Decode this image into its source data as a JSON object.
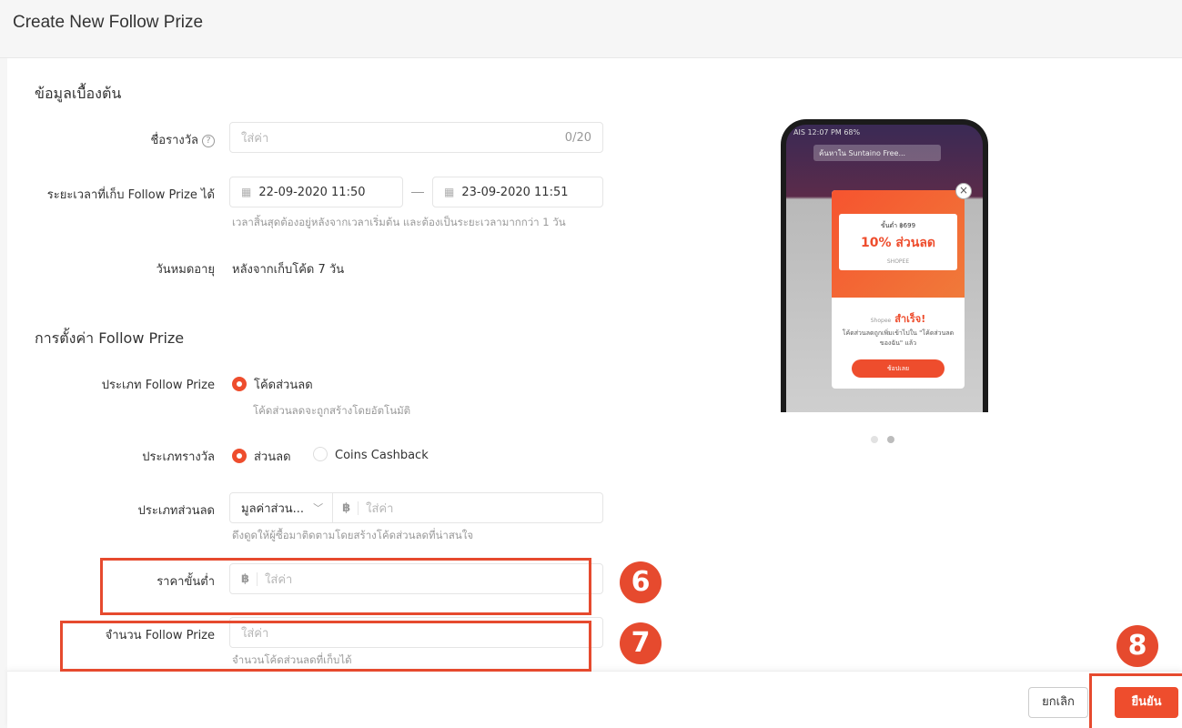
{
  "page": {
    "title": "Create New Follow Prize"
  },
  "basic": {
    "section_title": "ข้อมูลเบื้องต้น",
    "name_label": "ชื่อรางวัล",
    "help_glyph": "?",
    "name_placeholder": "ใส่ค่า",
    "name_count": "0/20",
    "period_label": "ระยะเวลาที่เก็บ Follow Prize ได้",
    "start_date": "22-09-2020 11:50",
    "end_date": "23-09-2020 11:51",
    "period_hint": "เวลาสิ้นสุดต้องอยู่หลังจากเวลาเริ่มต้น และต้องเป็นระยะเวลามากกว่า 1 วัน",
    "expiry_label": "วันหมดอายุ",
    "expiry_value": "หลังจากเก็บโค้ด 7 วัน"
  },
  "settings": {
    "section_title": "การตั้งค่า Follow Prize",
    "type_label": "ประเภท Follow Prize",
    "type_option": "โค้ดส่วนลด",
    "type_hint": "โค้ดส่วนลดจะถูกสร้างโดยอัตโนมัติ",
    "reward_label": "ประเภทรางวัล",
    "reward_option_discount": "ส่วนลด",
    "reward_option_coins": "Coins Cashback",
    "discount_type_label": "ประเภทส่วนลด",
    "discount_type_value": "มูลค่าส่วน...",
    "currency": "฿",
    "discount_placeholder": "ใส่ค่า",
    "discount_hint": "ดึงดูดให้ผู้ซื้อมาติดตามโดยสร้างโค้ดส่วนลดที่น่าสนใจ",
    "min_price_label": "ราคาขั้นต่ำ",
    "min_price_placeholder": "ใส่ค่า",
    "quantity_label": "จำนวน Follow Prize",
    "quantity_placeholder": "ใส่ค่า",
    "quantity_hint": "จำนวนโค้ดส่วนลดที่เก็บได้"
  },
  "preview": {
    "status": "AIS  12:07 PM  68%",
    "search": "ค้นหาใน Suntaino Free...",
    "voucher_min": "ขั้นต่ำ ฿699",
    "voucher_discount": "10% ส่วนลด",
    "voucher_shop": "SHOPEE",
    "success_brand": "Shopee",
    "success_text": "สำเร็จ!",
    "success_desc": "โค้ดส่วนลดถูกเพิ่มเข้าไปใน \"โค้ดส่วนลดของฉัน\" แล้ว",
    "success_button": "ช้อปเลย",
    "close_glyph": "×"
  },
  "footer": {
    "cancel_label": "ยกเลิก",
    "confirm_label": "ยืนยัน"
  },
  "annotations": {
    "six": "6",
    "seven": "7",
    "eight": "8"
  },
  "colors": {
    "accent": "#ee4d2d",
    "annotation": "#e64a2e"
  }
}
